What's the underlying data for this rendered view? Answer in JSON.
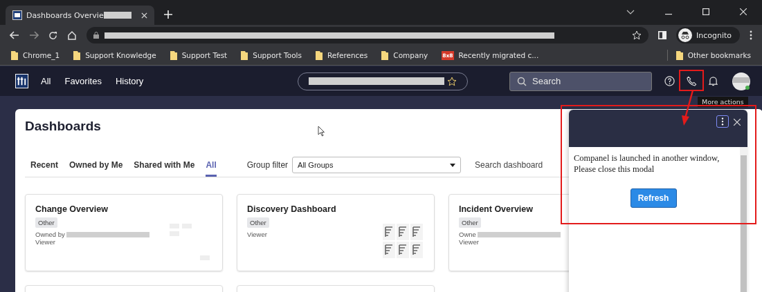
{
  "browser": {
    "tab_title": "Dashboards Overvie",
    "incognito_label": "Incognito",
    "bookmarks": [
      {
        "label": "Chrome_1",
        "kind": "folder"
      },
      {
        "label": "Support Knowledge",
        "kind": "folder"
      },
      {
        "label": "Support Test",
        "kind": "folder"
      },
      {
        "label": "Support Tools",
        "kind": "folder"
      },
      {
        "label": "References",
        "kind": "folder"
      },
      {
        "label": "Company",
        "kind": "folder"
      },
      {
        "label": "Recently migrated c...",
        "kind": "site",
        "badge": "8x8"
      }
    ],
    "other_bookmarks": "Other bookmarks"
  },
  "app": {
    "nav": [
      {
        "label": "All"
      },
      {
        "label": "Favorites"
      },
      {
        "label": "History"
      }
    ],
    "search": {
      "placeholder": "Search"
    },
    "tooltip": "More actions",
    "page_title": "Dashboards",
    "tabs": [
      {
        "label": "Recent",
        "selected": false
      },
      {
        "label": "Owned by Me",
        "selected": false
      },
      {
        "label": "Shared with Me",
        "selected": false
      },
      {
        "label": "All",
        "selected": true
      }
    ],
    "group_filter": {
      "label": "Group filter",
      "value": "All Groups"
    },
    "search_label": "Search dashboard",
    "cards": [
      {
        "title": "Change Overview",
        "tag": "Other",
        "owner": "Owned by",
        "role": "Viewer",
        "kind": "tiles"
      },
      {
        "title": "Discovery Dashboard",
        "tag": "Other",
        "role": "Viewer",
        "kind": "bars"
      },
      {
        "title": "Incident Overview",
        "tag": "Other",
        "owner": "Owne",
        "role": "Viewer",
        "kind": "plain"
      }
    ]
  },
  "modal": {
    "message": "Companel is launched in another window, Please close this modal",
    "button": "Refresh"
  }
}
